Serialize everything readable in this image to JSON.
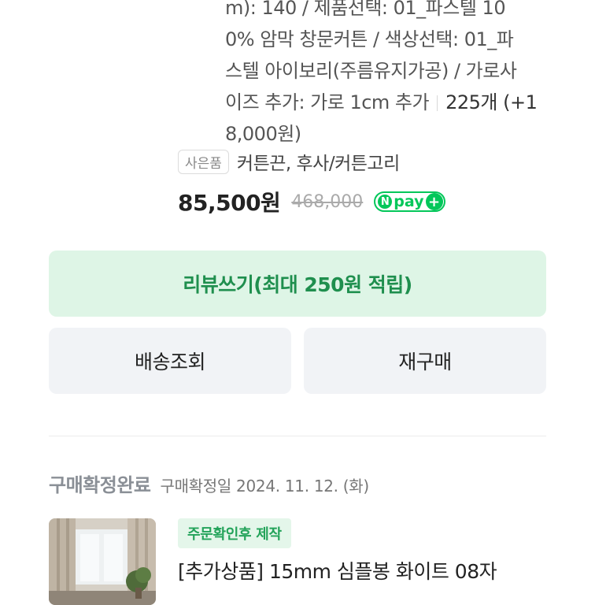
{
  "order_item": {
    "option_lines": [
      "m): 140 / 제품선택: 01_파스텔 10",
      "0% 암막 창문커튼 / 색상선택: 01_파",
      "스텔 아이보리(주름유지가공) / 가로사",
      "이즈 추가: 가로 1cm 추가",
      "8,000원)"
    ],
    "quantity_text": "225개 (+1",
    "gift_badge": "사은품",
    "gift_text": "커튼끈, 후사/커튼고리",
    "price": "85,500원",
    "original_price": "468,000",
    "npay": {
      "n": "N",
      "label": "pay",
      "plus": "+"
    }
  },
  "actions": {
    "review": "리뷰쓰기(최대 250원 적립)",
    "tracking": "배송조회",
    "reorder": "재구매"
  },
  "next_order": {
    "status": "구매확정완료",
    "date": "구매확정일 2024. 11. 12. (화)",
    "badge": "주문확인후 제작",
    "product_name": "[추가상품] 15mm 심플봉 화이트 08자"
  },
  "colors": {
    "accent_green": "#03c75a",
    "review_bg": "#def5e6",
    "button_bg": "#f1f3f6"
  }
}
